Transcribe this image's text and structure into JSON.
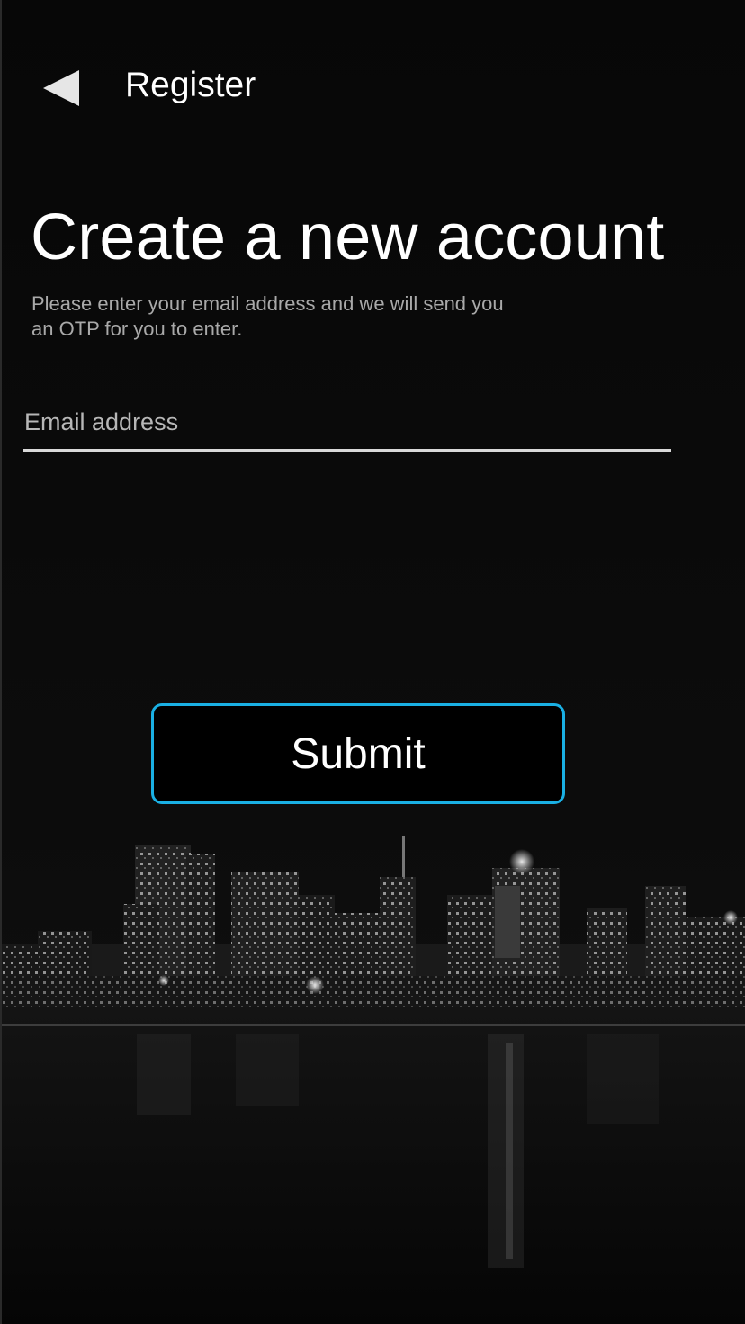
{
  "header": {
    "back_icon": "back-arrow-icon",
    "title": "Register"
  },
  "main": {
    "title": "Create a new account",
    "subtitle": "Please enter your email address and we will send you\nan OTP  for you to enter.",
    "email_field": {
      "value": "",
      "placeholder": "Email address"
    },
    "submit_label": "Submit"
  },
  "colors": {
    "accent": "#1ab0e4",
    "background": "#080808",
    "text": "#ffffff",
    "muted_text": "#a9a9a9"
  }
}
